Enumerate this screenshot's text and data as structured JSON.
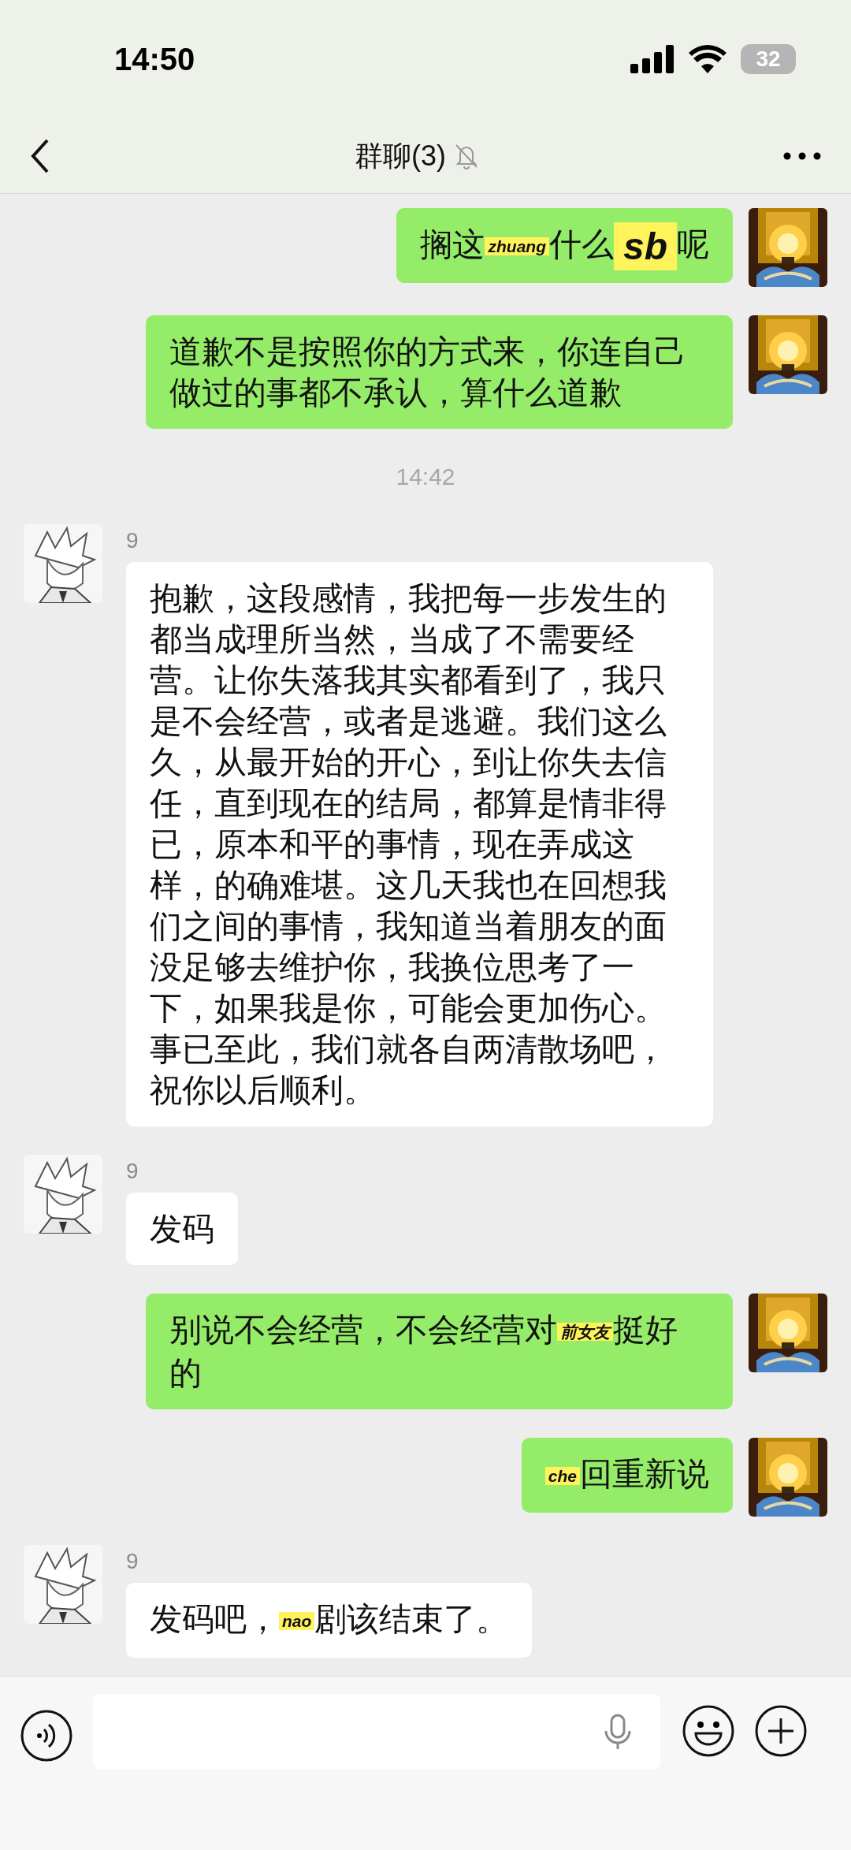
{
  "status_bar": {
    "time": "14:50",
    "battery": "32"
  },
  "header": {
    "title": "群聊(3)",
    "muted": true
  },
  "messages": [
    {
      "kind": "outgoing",
      "segments": [
        {
          "kind": "text",
          "text": "搁这"
        },
        {
          "kind": "tag",
          "text": "zhuang"
        },
        {
          "kind": "text",
          "text": "什么"
        },
        {
          "kind": "big-tag",
          "text": "sb"
        },
        {
          "kind": "text",
          "text": "呢"
        }
      ]
    },
    {
      "kind": "outgoing",
      "segments": [
        {
          "kind": "text",
          "text": "道歉不是按照你的方式来，你连自己做过的事都不承认，算什么道歉"
        }
      ]
    },
    {
      "kind": "time",
      "text": "14:42"
    },
    {
      "kind": "incoming",
      "sender": "9",
      "segments": [
        {
          "kind": "text",
          "text": "抱歉，这段感情，我把每一步发生的都当成理所当然，当成了不需要经营。让你失落我其实都看到了，我只是不会经营，或者是逃避。我们这么久，从最开始的开心，到让你失去信任，直到现在的结局，都算是情非得已，原本和平的事情，现在弄成这样，的确难堪。这几天我也在回想我们之间的事情，我知道当着朋友的面没足够去维护你，我换位思考了一下，如果我是你，可能会更加伤心。事已至此，我们就各自两清散场吧，祝你以后顺利。"
        }
      ]
    },
    {
      "kind": "incoming",
      "sender": "9",
      "segments": [
        {
          "kind": "text",
          "text": "发码"
        }
      ]
    },
    {
      "kind": "outgoing",
      "segments": [
        {
          "kind": "text",
          "text": "别说不会经营，不会经营对"
        },
        {
          "kind": "tag",
          "text": "前女友"
        },
        {
          "kind": "text",
          "text": "挺好的"
        }
      ]
    },
    {
      "kind": "outgoing",
      "segments": [
        {
          "kind": "tag",
          "text": "che"
        },
        {
          "kind": "text",
          "text": "回重新说"
        }
      ]
    },
    {
      "kind": "incoming",
      "sender": "9",
      "segments": [
        {
          "kind": "text",
          "text": "发码吧，"
        },
        {
          "kind": "tag",
          "text": "nao"
        },
        {
          "kind": "text",
          "text": "剧该结束了。"
        }
      ]
    }
  ]
}
